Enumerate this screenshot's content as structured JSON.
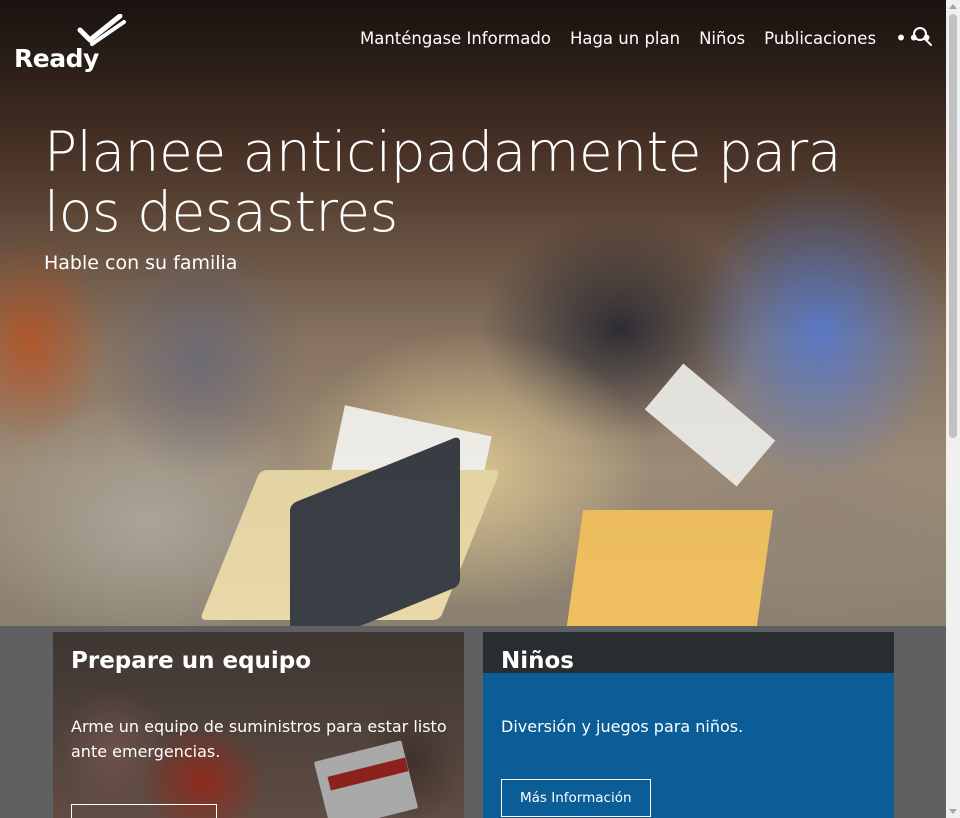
{
  "header": {
    "logo_text": "Ready",
    "nav": [
      {
        "label": "Manténgase Informado"
      },
      {
        "label": "Haga un plan"
      },
      {
        "label": "Niños"
      },
      {
        "label": "Publicaciones"
      }
    ],
    "more_label": "•••",
    "search_icon": "search-icon"
  },
  "hero": {
    "title": "Planee anticipadamente para los desastres",
    "subtitle": "Hable con su familia"
  },
  "cards": [
    {
      "title": "Prepare un equipo",
      "text": "Arme un equipo de suministros para estar listo ante emergencias.",
      "button_label": ""
    },
    {
      "title": "Niños",
      "text": "Diversión y juegos para niños.",
      "button_label": "Más Información"
    }
  ],
  "colors": {
    "kids_panel": "#0a5d96",
    "card_header_dark": "#2a2d2f",
    "page_background": "#5f6062"
  }
}
